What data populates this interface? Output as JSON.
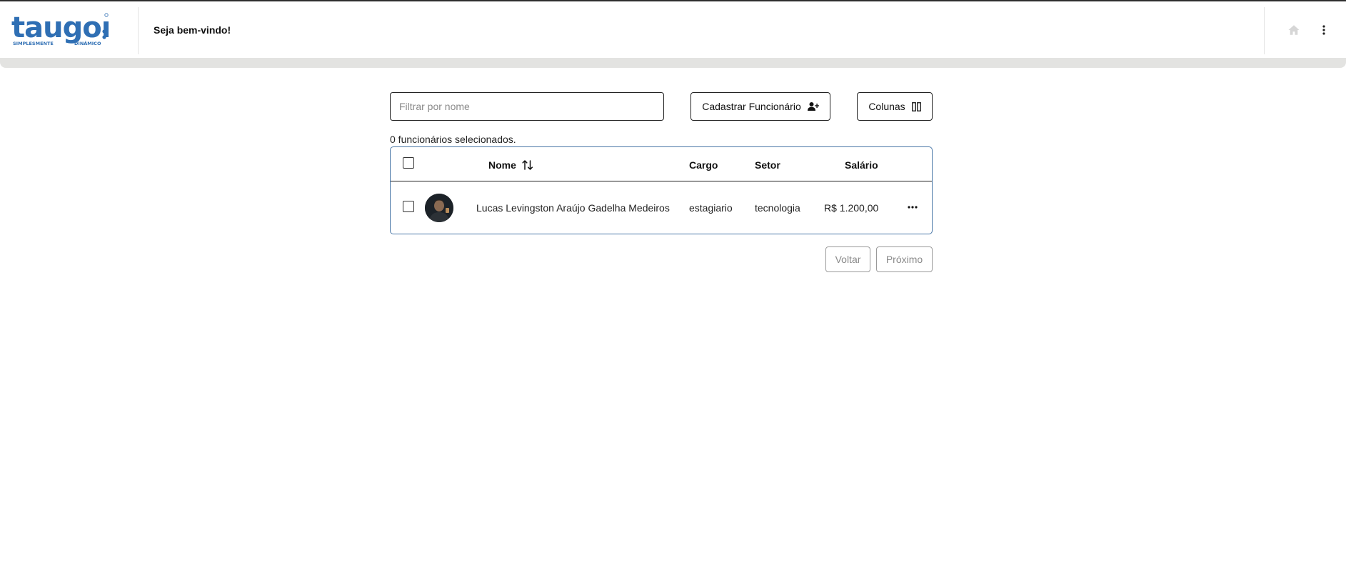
{
  "header": {
    "logo_text": "taugor",
    "logo_tagline_left": "SIMPLESMENTE",
    "logo_tagline_right": "DINÂMICO",
    "welcome": "Seja bem-vindo!",
    "home_icon": "home-icon",
    "menu_icon": "more-vertical-icon"
  },
  "progress": {
    "value": 1.0
  },
  "toolbar": {
    "search_placeholder": "Filtrar por nome",
    "search_value": "",
    "register_label": "Cadastrar Funcionário",
    "register_icon": "user-plus-icon",
    "columns_label": "Colunas",
    "columns_icon": "columns-icon"
  },
  "selection": {
    "text": "0 funcionários selecionados."
  },
  "table": {
    "columns": [
      "Nome",
      "Cargo",
      "Setor",
      "Salário"
    ],
    "rows": [
      {
        "nome": "Lucas Levingston Araújo Gadelha Medeiros",
        "cargo": "estagiario",
        "setor": "tecnologia",
        "salario": "R$ 1.200,00",
        "selected": false
      }
    ]
  },
  "pagination": {
    "prev_label": "Voltar",
    "next_label": "Próximo",
    "disabled": true
  },
  "colors": {
    "brand": "#2f6fb4",
    "table_border": "#4b78a8",
    "progress_track": "#e3e3e1",
    "disabled_text": "#8a8a8a"
  }
}
